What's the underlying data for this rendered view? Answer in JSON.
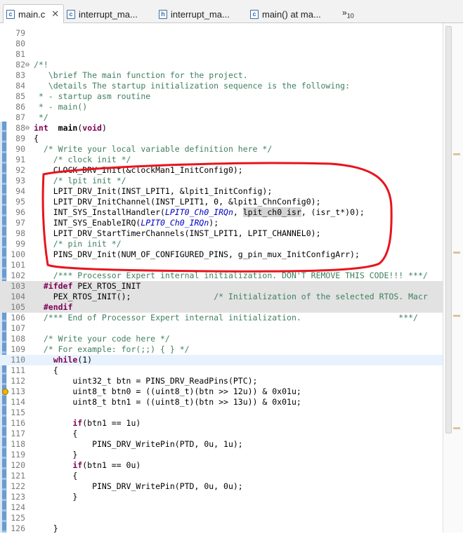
{
  "tabs": [
    {
      "label": "main.c",
      "icon": "c-file-icon",
      "glyph": "c",
      "active": true,
      "close": "✕"
    },
    {
      "label": "interrupt_ma...",
      "icon": "c-file-icon",
      "glyph": "c",
      "active": false
    },
    {
      "label": "interrupt_ma...",
      "icon": "h-file-icon",
      "glyph": "h",
      "active": false
    },
    {
      "label": "main() at ma...",
      "icon": "c-file-icon",
      "glyph": "c",
      "active": false
    }
  ],
  "overflow": {
    "glyph": "»",
    "count": "10"
  },
  "annotation_color": "#e8141e",
  "lines": [
    {
      "n": "79",
      "t": []
    },
    {
      "n": "80",
      "t": []
    },
    {
      "n": "81",
      "t": []
    },
    {
      "n": "82",
      "f": "⊖",
      "t": [
        [
          "cm",
          "/*!"
        ]
      ]
    },
    {
      "n": "83",
      "t": [
        [
          "cm",
          "   \\brief The main function for the project."
        ]
      ]
    },
    {
      "n": "84",
      "t": [
        [
          "cm",
          "   \\details The startup initialization sequence is the following:"
        ]
      ]
    },
    {
      "n": "85",
      "t": [
        [
          "cm",
          " * - startup asm routine"
        ]
      ]
    },
    {
      "n": "86",
      "t": [
        [
          "cm",
          " * - main()"
        ]
      ]
    },
    {
      "n": "87",
      "t": [
        [
          "cm",
          " */"
        ]
      ]
    },
    {
      "n": "88",
      "f": "⊖",
      "t": [
        [
          "kw",
          "int"
        ],
        [
          "",
          "  "
        ],
        [
          "b",
          "main"
        ],
        [
          "",
          "("
        ],
        [
          "kw",
          "void"
        ],
        [
          "",
          ")"
        ]
      ]
    },
    {
      "n": "89",
      "t": [
        [
          "",
          "{"
        ]
      ]
    },
    {
      "n": "90",
      "t": [
        [
          "cm",
          "  /* Write your local variable definition here */"
        ]
      ]
    },
    {
      "n": "91",
      "t": [
        [
          "cm",
          "    /* clock init */"
        ]
      ]
    },
    {
      "n": "92",
      "t": [
        [
          "",
          "    CLOCK_DRV_Init(&clockMan1_InitConfig0);"
        ]
      ]
    },
    {
      "n": "93",
      "t": [
        [
          "cm",
          "    /* lpit init */"
        ]
      ]
    },
    {
      "n": "94",
      "t": [
        [
          "",
          "    LPIT_DRV_Init(INST_LPIT1, &lpit1_InitConfig);"
        ]
      ]
    },
    {
      "n": "95",
      "t": [
        [
          "",
          "    LPIT_DRV_InitChannel(INST_LPIT1, 0, &lpit1_ChnConfig0);"
        ]
      ]
    },
    {
      "n": "96",
      "t": [
        [
          "",
          "    INT_SYS_InstallHandler("
        ],
        [
          "en",
          "LPIT0_Ch0_IRQn"
        ],
        [
          "",
          ", "
        ],
        [
          "hl",
          "lpit_ch0_isr"
        ],
        [
          "",
          ", (isr_t*)0);"
        ]
      ]
    },
    {
      "n": "97",
      "t": [
        [
          "",
          "    INT_SYS_EnableIRQ("
        ],
        [
          "en",
          "LPIT0_Ch0_IRQn"
        ],
        [
          "",
          ");"
        ]
      ]
    },
    {
      "n": "98",
      "t": [
        [
          "",
          "    LPIT_DRV_StartTimerChannels(INST_LPIT1, LPIT_CHANNEL0);"
        ]
      ]
    },
    {
      "n": "99",
      "t": [
        [
          "cm",
          "    /* pin init */"
        ]
      ]
    },
    {
      "n": "100",
      "t": [
        [
          "",
          "    PINS_DRV_Init(NUM_OF_CONFIGURED_PINS, g_pin_mux_InitConfigArr);"
        ]
      ]
    },
    {
      "n": "101",
      "t": []
    },
    {
      "n": "102",
      "t": [
        [
          "cm",
          "    /*** Processor Expert internal initialization. DON'T REMOVE THIS CODE!!! ***/"
        ]
      ]
    },
    {
      "n": "103",
      "bg": "inactive",
      "t": [
        [
          "pp",
          "  #ifdef"
        ],
        [
          "",
          " PEX_RTOS_INIT"
        ]
      ]
    },
    {
      "n": "104",
      "bg": "inactive",
      "t": [
        [
          "",
          "    PEX_RTOS_INIT();                 "
        ],
        [
          "cm",
          "/* Initialization of the selected RTOS. Macr"
        ]
      ]
    },
    {
      "n": "105",
      "bg": "inactive",
      "t": [
        [
          "pp",
          "  #endif"
        ]
      ]
    },
    {
      "n": "106",
      "t": [
        [
          "cm",
          "  /*** End of Processor Expert internal initialization.                    ***/"
        ]
      ]
    },
    {
      "n": "107",
      "t": []
    },
    {
      "n": "108",
      "t": [
        [
          "cm",
          "  /* Write your code here */"
        ]
      ]
    },
    {
      "n": "109",
      "t": [
        [
          "cm",
          "  /* For example: for(;;) { } */"
        ]
      ]
    },
    {
      "n": "110",
      "bg": "cur",
      "t": [
        [
          "kw",
          "    while"
        ],
        [
          "",
          "(1)"
        ]
      ]
    },
    {
      "n": "111",
      "t": [
        [
          "",
          "    {"
        ]
      ]
    },
    {
      "n": "112",
      "t": [
        [
          "",
          "        uint32_t btn = PINS_DRV_ReadPins(PTC);"
        ]
      ]
    },
    {
      "n": "113",
      "warn": true,
      "t": [
        [
          "",
          "        uint8_t btn0 = ((uint8_t)(btn >> 12u)) & 0x01u;"
        ]
      ]
    },
    {
      "n": "114",
      "t": [
        [
          "",
          "        uint8_t btn1 = ((uint8_t)(btn >> 13u)) & 0x01u;"
        ]
      ]
    },
    {
      "n": "115",
      "t": []
    },
    {
      "n": "116",
      "t": [
        [
          "kw",
          "        if"
        ],
        [
          "",
          "(btn1 == 1u)"
        ]
      ]
    },
    {
      "n": "117",
      "t": [
        [
          "",
          "        {"
        ]
      ]
    },
    {
      "n": "118",
      "t": [
        [
          "",
          "            PINS_DRV_WritePin(PTD, 0u, 1u);"
        ]
      ]
    },
    {
      "n": "119",
      "t": [
        [
          "",
          "        }"
        ]
      ]
    },
    {
      "n": "120",
      "t": [
        [
          "kw",
          "        if"
        ],
        [
          "",
          "(btn1 == 0u)"
        ]
      ]
    },
    {
      "n": "121",
      "t": [
        [
          "",
          "        {"
        ]
      ]
    },
    {
      "n": "122",
      "t": [
        [
          "",
          "            PINS_DRV_WritePin(PTD, 0u, 0u);"
        ]
      ]
    },
    {
      "n": "123",
      "t": [
        [
          "",
          "        }"
        ]
      ]
    },
    {
      "n": "124",
      "t": []
    },
    {
      "n": "125",
      "t": []
    },
    {
      "n": "126",
      "t": [
        [
          "",
          "    }"
        ]
      ]
    }
  ]
}
